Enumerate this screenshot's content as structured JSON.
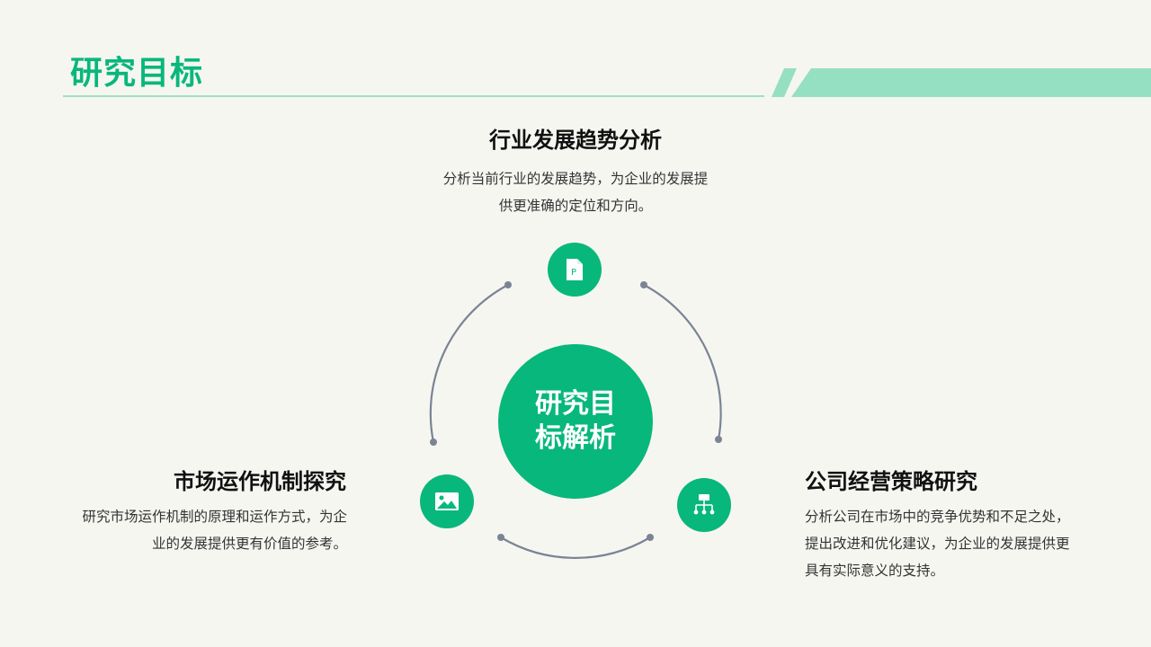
{
  "header": {
    "title": "研究目标"
  },
  "center": {
    "line1": "研究目",
    "line2": "标解析"
  },
  "blocks": {
    "top": {
      "heading": "行业发展趋势分析",
      "text_line1": "分析当前行业的发展趋势，为企业的发展提",
      "text_line2": "供更准确的定位和方向。",
      "icon": "document-p-icon"
    },
    "left": {
      "heading": "市场运作机制探究",
      "text_line1": "研究市场运作机制的原理和运作方式，为企",
      "text_line2": "业的发展提供更有价值的参考。",
      "icon": "image-icon"
    },
    "right": {
      "heading": "公司经营策略研究",
      "text_line1": "分析公司在市场中的竞争优势和不足之处，",
      "text_line2": "提出改进和优化建议，为企业的发展提供更",
      "text_line3": "具有实际意义的支持。",
      "icon": "org-chart-icon"
    }
  },
  "colors": {
    "accent": "#08b77c",
    "accent_light": "#95dfc3",
    "ring": "#7b8494",
    "background": "#f6f6f1"
  }
}
